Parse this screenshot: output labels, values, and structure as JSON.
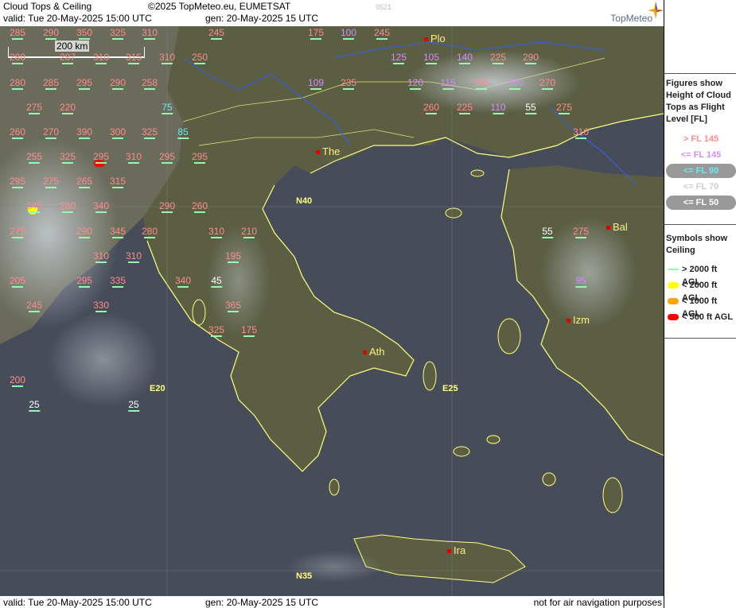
{
  "header": {
    "product": "Cloud Tops & Ceiling",
    "copyright": "©2025 TopMeteo.eu, EUMETSAT",
    "valid": "valid:  Tue   20-May-2025   15:00 UTC",
    "generated": "gen: 20-May-2025 15 UTC",
    "code": "9521",
    "logo": "TopMeteo"
  },
  "footer": {
    "valid": "valid:  Tue   20-May-2025   15:00 UTC",
    "generated": "gen: 20-May-2025 15 UTC",
    "disclaimer": "not for air navigation purposes"
  },
  "scale_bar": "200 km",
  "grid_labels": [
    "N40",
    "N35",
    "E20",
    "E25"
  ],
  "cities": [
    "Plo",
    "The",
    "Bal",
    "Ath",
    "Izm",
    "Ira"
  ],
  "colors": {
    "above_fl145": "#ff8c8c",
    "below_fl145": "#d38cff",
    "below_fl90": "#6de8f0",
    "below_fl70": "#cccccc",
    "below_fl50": "#ffffff",
    "ceiling_above_2000": "#9af5b0",
    "ceiling_below_2000": "#ffff00",
    "ceiling_below_1000": "#ffa500",
    "ceiling_below_500": "#ff0000",
    "coastline": "#ffff80",
    "rivers": "#3a5fd0",
    "map_background": "#474c59"
  },
  "cloud_tops": [
    {
      "v": "285",
      "c": "red"
    },
    {
      "v": "290",
      "c": "red"
    },
    {
      "v": "350",
      "c": "red"
    },
    {
      "v": "325",
      "c": "red"
    },
    {
      "v": "310",
      "c": "red"
    },
    {
      "v": "245",
      "c": "red"
    },
    {
      "v": "175",
      "c": "red"
    },
    {
      "v": "100",
      "c": "vio"
    },
    {
      "v": "245",
      "c": "red"
    },
    {
      "v": "280",
      "c": "red"
    },
    {
      "v": "287",
      "c": "red"
    },
    {
      "v": "310",
      "c": "red"
    },
    {
      "v": "315",
      "c": "red"
    },
    {
      "v": "310",
      "c": "red"
    },
    {
      "v": "250",
      "c": "red"
    },
    {
      "v": "125",
      "c": "vio"
    },
    {
      "v": "105",
      "c": "vio"
    },
    {
      "v": "140",
      "c": "vio"
    },
    {
      "v": "225",
      "c": "red"
    },
    {
      "v": "290",
      "c": "red"
    },
    {
      "v": "280",
      "c": "red"
    },
    {
      "v": "285",
      "c": "red"
    },
    {
      "v": "295",
      "c": "red"
    },
    {
      "v": "290",
      "c": "red"
    },
    {
      "v": "258",
      "c": "red"
    },
    {
      "v": "109",
      "c": "vio"
    },
    {
      "v": "235",
      "c": "red"
    },
    {
      "v": "120",
      "c": "vio"
    },
    {
      "v": "115",
      "c": "vio"
    },
    {
      "v": "155",
      "c": "red"
    },
    {
      "v": "120",
      "c": "vio"
    },
    {
      "v": "270",
      "c": "red"
    },
    {
      "v": "275",
      "c": "red"
    },
    {
      "v": "220",
      "c": "red"
    },
    {
      "v": "75",
      "c": "cyan"
    },
    {
      "v": "260",
      "c": "red"
    },
    {
      "v": "225",
      "c": "red"
    },
    {
      "v": "110",
      "c": "vio"
    },
    {
      "v": "55",
      "c": "white"
    },
    {
      "v": "275",
      "c": "red"
    },
    {
      "v": "260",
      "c": "red"
    },
    {
      "v": "270",
      "c": "red"
    },
    {
      "v": "390",
      "c": "red"
    },
    {
      "v": "300",
      "c": "red"
    },
    {
      "v": "325",
      "c": "red"
    },
    {
      "v": "85",
      "c": "cyan"
    },
    {
      "v": "310",
      "c": "red"
    },
    {
      "v": "255",
      "c": "red"
    },
    {
      "v": "325",
      "c": "red"
    },
    {
      "v": "295",
      "c": "red"
    },
    {
      "v": "310",
      "c": "red"
    },
    {
      "v": "295",
      "c": "red"
    },
    {
      "v": "295",
      "c": "red"
    },
    {
      "v": "295",
      "c": "red"
    },
    {
      "v": "275",
      "c": "red"
    },
    {
      "v": "265",
      "c": "red"
    },
    {
      "v": "315",
      "c": "red"
    },
    {
      "v": "245",
      "c": "red"
    },
    {
      "v": "280",
      "c": "red"
    },
    {
      "v": "340",
      "c": "red"
    },
    {
      "v": "290",
      "c": "red"
    },
    {
      "v": "260",
      "c": "red"
    },
    {
      "v": "275",
      "c": "red"
    },
    {
      "v": "290",
      "c": "red"
    },
    {
      "v": "345",
      "c": "red"
    },
    {
      "v": "280",
      "c": "red"
    },
    {
      "v": "310",
      "c": "red"
    },
    {
      "v": "210",
      "c": "red"
    },
    {
      "v": "55",
      "c": "white"
    },
    {
      "v": "275",
      "c": "red"
    },
    {
      "v": "310",
      "c": "red"
    },
    {
      "v": "310",
      "c": "red"
    },
    {
      "v": "195",
      "c": "red"
    },
    {
      "v": "205",
      "c": "red"
    },
    {
      "v": "295",
      "c": "red"
    },
    {
      "v": "335",
      "c": "red"
    },
    {
      "v": "340",
      "c": "red"
    },
    {
      "v": "45",
      "c": "white"
    },
    {
      "v": "95",
      "c": "vio"
    },
    {
      "v": "245",
      "c": "red"
    },
    {
      "v": "330",
      "c": "red"
    },
    {
      "v": "365",
      "c": "red"
    },
    {
      "v": "325",
      "c": "red"
    },
    {
      "v": "175",
      "c": "red"
    },
    {
      "v": "200",
      "c": "red"
    },
    {
      "v": "25",
      "c": "white"
    },
    {
      "v": "25",
      "c": "white"
    }
  ],
  "ceiling_markers": [
    "< 500 ft AGL",
    "< 2000 ft AGL"
  ],
  "legend": {
    "tops_title": "Figures show Height of Cloud Tops as Flight Level  [FL]",
    "tops_items": [
      "> FL 145",
      "<= FL 145",
      "<= FL 90",
      "<= FL 70",
      "<= FL 50"
    ],
    "ceiling_title": "Symbols show Ceiling",
    "ceiling_items": [
      "> 2000 ft AGL",
      "< 2000 ft AGL",
      "< 1000 ft AGL",
      "< 500 ft AGL"
    ]
  }
}
